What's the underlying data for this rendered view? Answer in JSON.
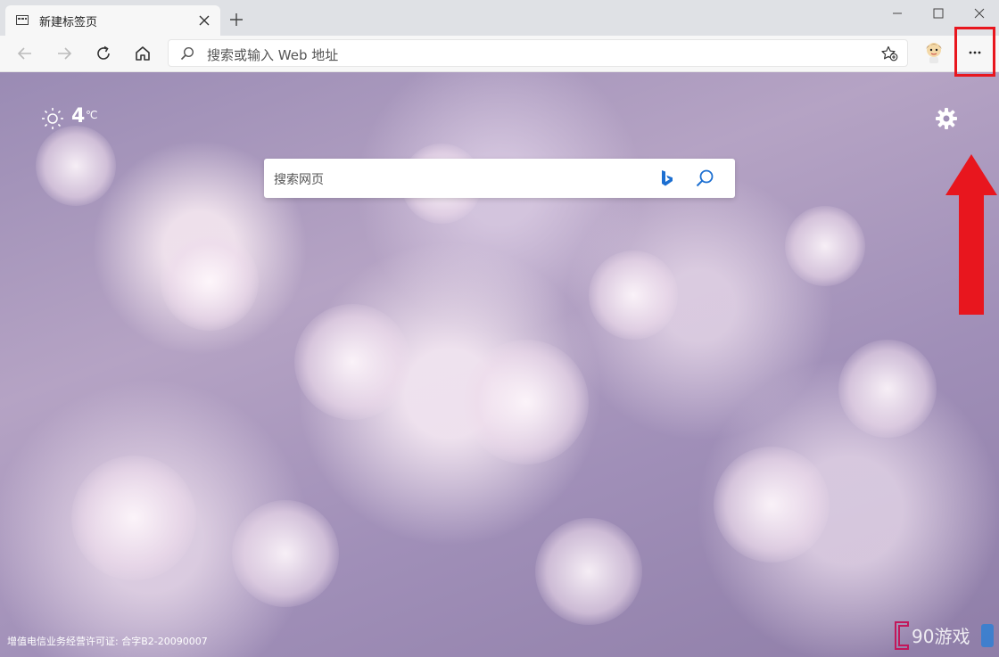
{
  "tab": {
    "title": "新建标签页",
    "close_icon": "close-icon",
    "favicon": "new-tab-page-icon"
  },
  "window": {
    "minimize_icon": "minimize-icon",
    "maximize_icon": "maximize-icon",
    "close_icon": "close-icon"
  },
  "toolbar": {
    "back_icon": "arrow-left-icon",
    "forward_icon": "arrow-right-icon",
    "refresh_icon": "refresh-icon",
    "home_icon": "home-icon",
    "address_placeholder": "搜索或输入 Web 地址",
    "favorite_icon": "star-add-icon",
    "more_icon": "ellipsis-icon"
  },
  "newtab": {
    "weather_temp": "4",
    "weather_unit": "℃",
    "search_placeholder": "搜索网页",
    "footer": "增值电信业务经营许可证: 合字B2-20090007"
  },
  "annotation": {
    "color": "#e8161e"
  }
}
